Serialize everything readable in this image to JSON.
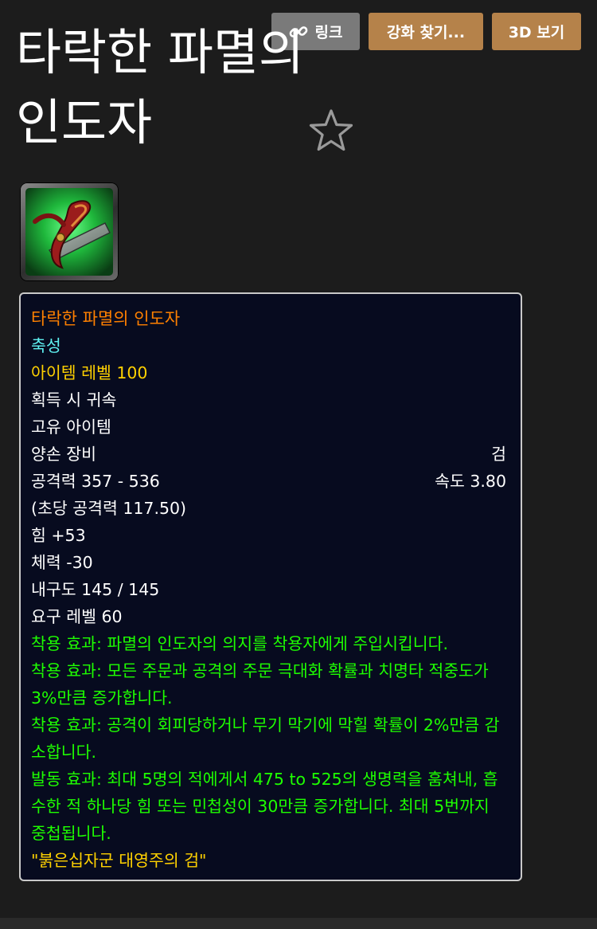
{
  "toolbar": {
    "link_label": "링크",
    "enchant_label": "강화 찾기...",
    "view3d_label": "3D 보기"
  },
  "item": {
    "title": "타락한 파멸의 인도자",
    "favorite_icon": "star-outline-icon",
    "image_icon": "sword-item-icon"
  },
  "tooltip": {
    "name": "타락한 파멸의 인도자",
    "tier": "축성",
    "item_level": "아이템 레벨 100",
    "bind": "획득 시 귀속",
    "unique": "고유 아이템",
    "slot": "양손 장비",
    "type": "검",
    "damage": "공격력 357 - 536",
    "speed": "속도 3.80",
    "dps": "(초당 공격력 117.50)",
    "strength": "힘 +53",
    "stamina": "체력 -30",
    "durability": "내구도 145 / 145",
    "required_level": "요구 레벨 60",
    "effects": [
      "착용 효과: 파멸의 인도자의 의지를 착용자에게 주입시킵니다.",
      "착용 효과: 모든 주문과 공격의 주문 극대화 확률과 치명타 적중도가 3%만큼 증가합니다.",
      "착용 효과: 공격이 회피당하거나 무기 막기에 막힐 확률이 2%만큼 감소합니다.",
      "발동 효과: 최대 5명의 적에게서 475 to 525의 생명력을 훔쳐내, 흡수한 적 하나당 힘 또는 민첩성이 30만큼 증가합니다. 최대 5번까지 중첩됩니다."
    ],
    "flavor": "\"붉은십자군 대영주의 검\""
  },
  "colors": {
    "background": "#1c1c1c",
    "button_gray": "#7a7a7a",
    "button_gold": "#b5824a",
    "tooltip_bg": "#070b1f",
    "item_name_orange": "#ff8000",
    "tier_cyan": "#5ff1f1",
    "item_level_yellow": "#ffd100",
    "effect_green": "#1eff00"
  }
}
